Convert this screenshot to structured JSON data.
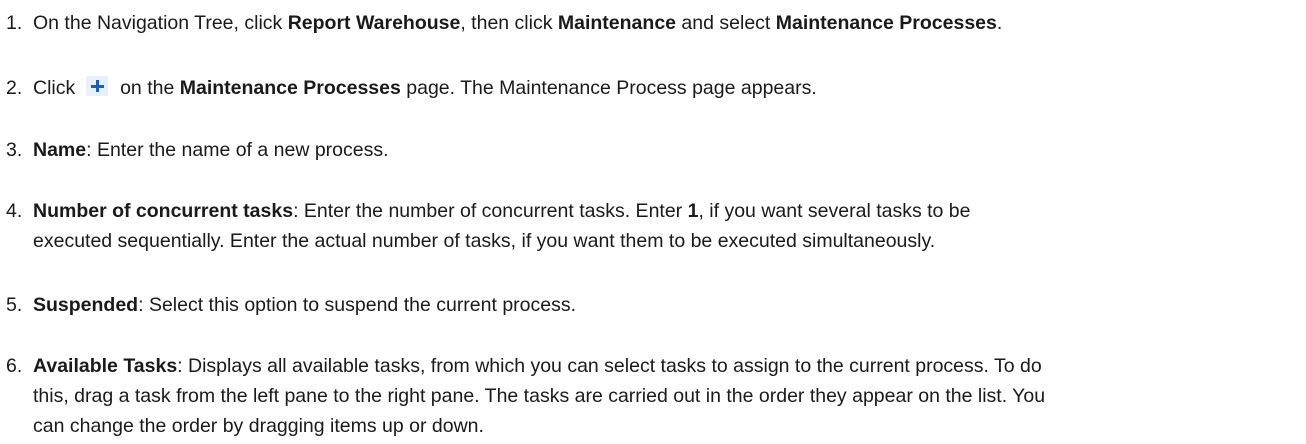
{
  "steps": [
    {
      "number": "1.",
      "parts": [
        "On the Navigation Tree, click ",
        "Report Warehouse",
        ", then click ",
        "Maintenance",
        " and select ",
        "Maintenance Processes",
        "."
      ]
    },
    {
      "number": "2.",
      "icon": "plus-icon",
      "parts": [
        "Click ",
        " on the ",
        "Maintenance Processes",
        " page. The Maintenance Process page appears."
      ]
    },
    {
      "number": "3.",
      "parts": [
        "Name",
        ": Enter the name of a new process."
      ]
    },
    {
      "number": "4.",
      "parts": [
        "Number of concurrent tasks",
        ": Enter the number of concurrent tasks. Enter ",
        "1",
        ", if you want several tasks to be",
        "executed sequentially. Enter the actual number of tasks, if you want them to be executed simultaneously."
      ]
    },
    {
      "number": "5.",
      "parts": [
        "Suspended",
        ": Select this option to suspend the current process."
      ]
    },
    {
      "number": "6.",
      "parts": [
        "Available Tasks",
        ": Displays all available tasks, from which you can select tasks to assign to the current process. To do",
        "this, drag a task from the left pane to the right pane. The tasks are carried out in the order they appear on the list. You",
        "can change the order by dragging items up or down."
      ]
    }
  ]
}
